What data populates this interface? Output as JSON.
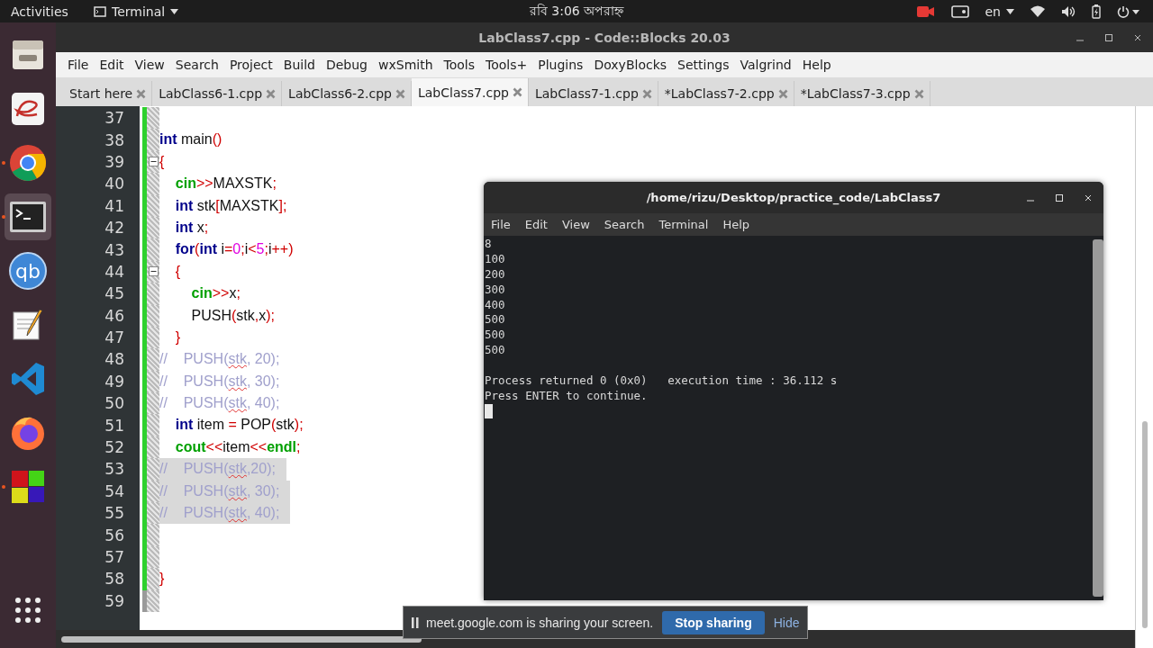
{
  "top_bar": {
    "activities": "Activities",
    "app_menu": "Terminal",
    "clock": "রবি  3:06 অপরাহ্ন",
    "language": "en"
  },
  "dock": [
    {
      "kind": "files",
      "running": false,
      "selected": false
    },
    {
      "kind": "office",
      "running": false,
      "selected": false
    },
    {
      "kind": "browser",
      "running": true,
      "selected": false
    },
    {
      "kind": "terminal",
      "running": true,
      "selected": true
    },
    {
      "kind": "torrent",
      "label": "qb",
      "running": false,
      "selected": false
    },
    {
      "kind": "notepad",
      "running": false,
      "selected": false
    },
    {
      "kind": "code",
      "running": false,
      "selected": false
    },
    {
      "kind": "firefox",
      "running": false,
      "selected": false
    },
    {
      "kind": "cubes",
      "running": true,
      "selected": false
    },
    {
      "kind": "grid",
      "running": false,
      "selected": false
    }
  ],
  "window": {
    "title": "LabClass7.cpp - Code::Blocks 20.03",
    "menu": [
      "File",
      "Edit",
      "View",
      "Search",
      "Project",
      "Build",
      "Debug",
      "wxSmith",
      "Tools",
      "Tools+",
      "Plugins",
      "DoxyBlocks",
      "Settings",
      "Valgrind",
      "Help"
    ],
    "tabs": [
      {
        "label": "Start here",
        "selected": false
      },
      {
        "label": "LabClass6-1.cpp",
        "selected": false
      },
      {
        "label": "LabClass6-2.cpp",
        "selected": false
      },
      {
        "label": "LabClass7.cpp",
        "selected": true
      },
      {
        "label": "LabClass7-1.cpp",
        "selected": false
      },
      {
        "label": "*LabClass7-2.cpp",
        "selected": false
      },
      {
        "label": "*LabClass7-3.cpp",
        "selected": false
      }
    ]
  },
  "editor": {
    "lines": [
      {
        "number": "37",
        "changed": true,
        "fold": false,
        "selected": false
      },
      {
        "number": "38",
        "changed": true,
        "fold": false,
        "selected": false,
        "tokens": [
          {
            "kind": "keyword",
            "text": "int"
          },
          {
            "kind": "ident",
            "text": " main"
          },
          {
            "kind": "op",
            "text": "()"
          }
        ]
      },
      {
        "number": "39",
        "changed": true,
        "fold": true,
        "selected": false,
        "tokens": [
          {
            "kind": "op",
            "text": "{"
          }
        ]
      },
      {
        "number": "40",
        "changed": true,
        "fold": false,
        "selected": false,
        "tokens": [
          {
            "kind": "stdlib",
            "text": "    cin"
          },
          {
            "kind": "op",
            "text": ">>"
          },
          {
            "kind": "ident",
            "text": "MAXSTK"
          },
          {
            "kind": "op",
            "text": ";"
          }
        ]
      },
      {
        "number": "41",
        "changed": true,
        "fold": false,
        "selected": false,
        "tokens": [
          {
            "kind": "keyword",
            "text": "    int"
          },
          {
            "kind": "ident",
            "text": " stk"
          },
          {
            "kind": "op",
            "text": "["
          },
          {
            "kind": "ident",
            "text": "MAXSTK"
          },
          {
            "kind": "op",
            "text": "];"
          }
        ]
      },
      {
        "number": "42",
        "changed": true,
        "fold": false,
        "selected": false,
        "tokens": [
          {
            "kind": "keyword",
            "text": "    int"
          },
          {
            "kind": "ident",
            "text": " x"
          },
          {
            "kind": "op",
            "text": ";"
          }
        ]
      },
      {
        "number": "43",
        "changed": true,
        "fold": false,
        "selected": false,
        "tokens": [
          {
            "kind": "keyword",
            "text": "    for"
          },
          {
            "kind": "op",
            "text": "("
          },
          {
            "kind": "keyword",
            "text": "int"
          },
          {
            "kind": "ident",
            "text": " i"
          },
          {
            "kind": "op",
            "text": "="
          },
          {
            "kind": "number",
            "text": "0"
          },
          {
            "kind": "op",
            "text": ";"
          },
          {
            "kind": "ident",
            "text": "i"
          },
          {
            "kind": "op",
            "text": "<"
          },
          {
            "kind": "number",
            "text": "5"
          },
          {
            "kind": "op",
            "text": ";"
          },
          {
            "kind": "ident",
            "text": "i"
          },
          {
            "kind": "op",
            "text": "++)"
          }
        ]
      },
      {
        "number": "44",
        "changed": true,
        "fold": true,
        "selected": false,
        "tokens": [
          {
            "kind": "op",
            "text": "    {"
          }
        ]
      },
      {
        "number": "45",
        "changed": true,
        "fold": false,
        "selected": false,
        "tokens": [
          {
            "kind": "stdlib",
            "text": "        cin"
          },
          {
            "kind": "op",
            "text": ">>"
          },
          {
            "kind": "ident",
            "text": "x"
          },
          {
            "kind": "op",
            "text": ";"
          }
        ]
      },
      {
        "number": "46",
        "changed": true,
        "fold": false,
        "selected": false,
        "tokens": [
          {
            "kind": "ident",
            "text": "        PUSH"
          },
          {
            "kind": "op",
            "text": "("
          },
          {
            "kind": "ident",
            "text": "stk"
          },
          {
            "kind": "op",
            "text": ","
          },
          {
            "kind": "ident",
            "text": "x"
          },
          {
            "kind": "op",
            "text": ");"
          }
        ]
      },
      {
        "number": "47",
        "changed": true,
        "fold": false,
        "selected": false,
        "tokens": [
          {
            "kind": "op",
            "text": "    }"
          }
        ]
      },
      {
        "number": "48",
        "changed": true,
        "fold": false,
        "selected": false,
        "tokens": [
          {
            "kind": "comment",
            "text": "//    PUSH("
          },
          {
            "kind": "typo",
            "text": "stk"
          },
          {
            "kind": "comment",
            "text": ", 20);"
          }
        ]
      },
      {
        "number": "49",
        "changed": true,
        "fold": false,
        "selected": false,
        "tokens": [
          {
            "kind": "comment",
            "text": "//    PUSH("
          },
          {
            "kind": "typo",
            "text": "stk"
          },
          {
            "kind": "comment",
            "text": ", 30);"
          }
        ]
      },
      {
        "number": "50",
        "changed": true,
        "fold": false,
        "selected": false,
        "tokens": [
          {
            "kind": "comment",
            "text": "//    PUSH("
          },
          {
            "kind": "typo",
            "text": "stk"
          },
          {
            "kind": "comment",
            "text": ", 40);"
          }
        ]
      },
      {
        "number": "51",
        "changed": true,
        "fold": false,
        "selected": false,
        "tokens": [
          {
            "kind": "keyword",
            "text": "    int"
          },
          {
            "kind": "ident",
            "text": " item "
          },
          {
            "kind": "op",
            "text": "="
          },
          {
            "kind": "ident",
            "text": " POP"
          },
          {
            "kind": "op",
            "text": "("
          },
          {
            "kind": "ident",
            "text": "stk"
          },
          {
            "kind": "op",
            "text": ");"
          }
        ]
      },
      {
        "number": "52",
        "changed": true,
        "fold": false,
        "selected": false,
        "tokens": [
          {
            "kind": "stdlib",
            "text": "    cout"
          },
          {
            "kind": "op",
            "text": "<<"
          },
          {
            "kind": "ident",
            "text": "item"
          },
          {
            "kind": "op",
            "text": "<<"
          },
          {
            "kind": "stdlib",
            "text": "endl"
          },
          {
            "kind": "op",
            "text": ";"
          }
        ]
      },
      {
        "number": "53",
        "changed": true,
        "fold": false,
        "selected": true,
        "tokens": [
          {
            "kind": "comment",
            "text": "//    PUSH("
          },
          {
            "kind": "typo",
            "text": "stk"
          },
          {
            "kind": "comment",
            "text": ",20);"
          }
        ]
      },
      {
        "number": "54",
        "changed": true,
        "fold": false,
        "selected": true,
        "tokens": [
          {
            "kind": "comment",
            "text": "//    PUSH("
          },
          {
            "kind": "typo",
            "text": "stk"
          },
          {
            "kind": "comment",
            "text": ", 30);"
          }
        ]
      },
      {
        "number": "55",
        "changed": true,
        "fold": false,
        "selected": true,
        "tokens": [
          {
            "kind": "comment",
            "text": "//    PUSH("
          },
          {
            "kind": "typo",
            "text": "stk"
          },
          {
            "kind": "comment",
            "text": ", 40);"
          }
        ]
      },
      {
        "number": "56",
        "changed": true,
        "fold": false,
        "selected": false
      },
      {
        "number": "57",
        "changed": true,
        "fold": false,
        "selected": false
      },
      {
        "number": "58",
        "changed": true,
        "fold": false,
        "selected": false,
        "tokens": [
          {
            "kind": "op",
            "text": "}"
          }
        ]
      },
      {
        "number": "59",
        "changed": false,
        "fold": false,
        "selected": false
      }
    ]
  },
  "terminal": {
    "title": "/home/rizu/Desktop/practice_code/LabClass7",
    "menu": [
      "File",
      "Edit",
      "View",
      "Search",
      "Terminal",
      "Help"
    ],
    "output_blocks": [
      [
        "8",
        "100",
        "200",
        "300",
        "400",
        "500",
        "500",
        "500"
      ],
      [
        "Process returned 0 (0x0)   execution time : 36.112 s",
        "Press ENTER to continue."
      ]
    ]
  },
  "share_bar": {
    "message": "meet.google.com is sharing your screen.",
    "stop_button": "Stop sharing",
    "hide_link": "Hide"
  }
}
